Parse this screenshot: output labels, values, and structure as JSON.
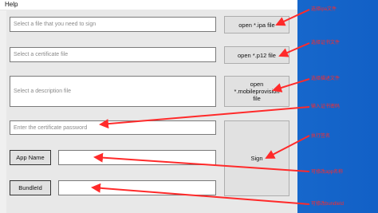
{
  "menu": {
    "help": "Help"
  },
  "fields": {
    "ipa_placeholder": "Select a file that you need to sign",
    "cert_placeholder": "Select a certificate file",
    "desc_placeholder": "Select a description file",
    "password_placeholder": "Enter the certificate password",
    "app_name_value": "",
    "bundle_id_value": ""
  },
  "buttons": {
    "open_ipa": "open *.ipa file",
    "open_p12": "open *.p12 file",
    "open_mobileprovision": "open *.mobileprovision file",
    "sign": "Sign",
    "app_name": "App Name",
    "bundle_id": "BundleId"
  },
  "annotations": {
    "a1": "选择ipa文件",
    "a2": "选择证书文件",
    "a3": "选择描述文件",
    "a4": "输入证书密码",
    "a5": "执行签名",
    "a6": "可修改app名称",
    "a7": "可修改bundleId"
  },
  "colors": {
    "annotation": "#ff2a2a",
    "desktop": "#1565c8",
    "window": "#f0f0f0"
  }
}
